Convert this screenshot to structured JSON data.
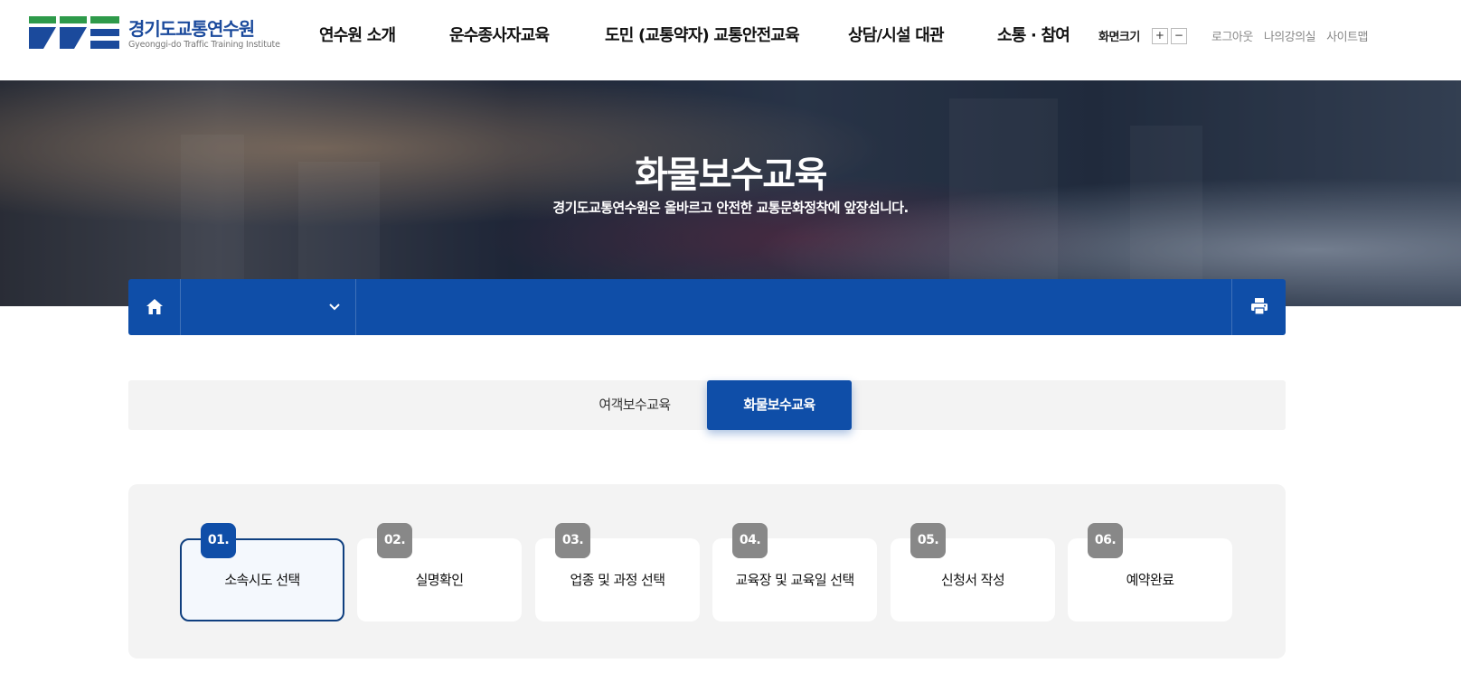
{
  "header": {
    "logo_title": "경기도교통연수원",
    "logo_subtitle": "Gyeonggi-do Traffic Training Institute",
    "nav": [
      {
        "label": "연수원 소개"
      },
      {
        "label": "운수종사자교육"
      },
      {
        "label": "도민 (교통약자) 교통안전교육"
      },
      {
        "label": "상담/시설 대관"
      },
      {
        "label": "소통 · 참여"
      }
    ],
    "font_size_label": "화면크기",
    "font_plus": "+",
    "font_minus": "−",
    "util_links": [
      "로그아웃",
      "나의강의실",
      "사이트맵"
    ]
  },
  "hero": {
    "title": "화물보수교육",
    "subtitle": "경기도교통연수원은 올바르고 안전한 교통문화정착에 앞장섭니다."
  },
  "location_bar": {
    "selected": ""
  },
  "tabs": [
    {
      "label": "여객보수교육",
      "active": false
    },
    {
      "label": "화물보수교육",
      "active": true
    }
  ],
  "steps": [
    {
      "number": "01.",
      "label": "소속시도 선택",
      "active": true
    },
    {
      "number": "02.",
      "label": "실명확인",
      "active": false
    },
    {
      "number": "03.",
      "label": "업종 및 과정 선택",
      "active": false
    },
    {
      "number": "04.",
      "label": "교육장 및 교육일 선택",
      "active": false
    },
    {
      "number": "05.",
      "label": "신청서 작성",
      "active": false
    },
    {
      "number": "06.",
      "label": "예약완료",
      "active": false
    }
  ],
  "colors": {
    "primary": "#0f4ea8",
    "logo_green": "#2e9a4a",
    "logo_blue": "#1b4a9c",
    "step_inactive": "#888888"
  }
}
